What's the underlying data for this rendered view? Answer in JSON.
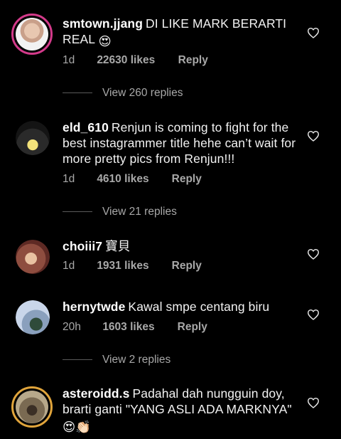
{
  "comments": [
    {
      "username": "smtown.jjang",
      "text": "DI LIKE MARK BERARTI REAL",
      "emoji": "😍",
      "time": "1d",
      "likes": "22630 likes",
      "reply": "Reply",
      "view_replies": "View 260 replies"
    },
    {
      "username": "eld_610",
      "text": "Renjun is coming to fight for the best instagrammer title hehe can’t wait for more pretty pics from Renjun!!!",
      "time": "1d",
      "likes": "4610 likes",
      "reply": "Reply",
      "view_replies": "View 21 replies"
    },
    {
      "username": "choiii7",
      "text": "寶貝",
      "time": "1d",
      "likes": "1931 likes",
      "reply": "Reply"
    },
    {
      "username": "hernytwde",
      "text": "Kawal smpe centang biru",
      "time": "20h",
      "likes": "1603 likes",
      "reply": "Reply",
      "view_replies": "View 2 replies"
    },
    {
      "username": "asteroidd.s",
      "text": "Padahal dah nungguin doy, brarti ganti \"YANG ASLI ADA MARKNYA\"",
      "emoji": "😍👏🏻"
    }
  ],
  "icons": {
    "like": "heart-outline-icon"
  },
  "colors": {
    "background": "#000000",
    "story_ring_pink": "#d33a8a",
    "story_ring_gold": "#e0a43b",
    "muted_text": "#a8a8a8"
  }
}
